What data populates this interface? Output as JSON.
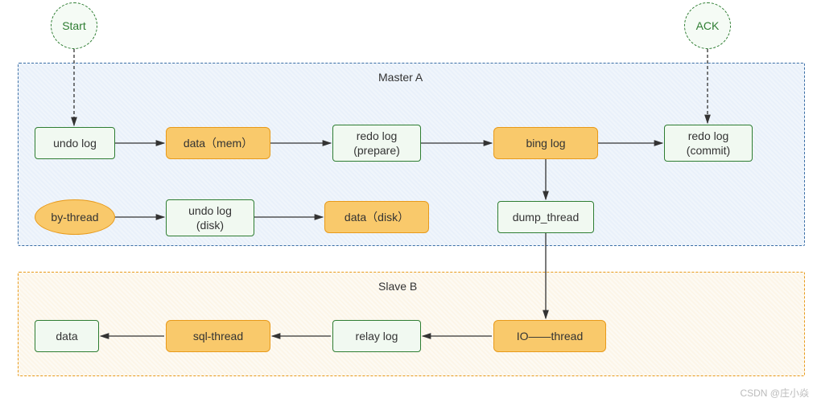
{
  "circles": {
    "start": "Start",
    "ack": "ACK"
  },
  "master": {
    "label": "Master A",
    "row1": {
      "undo_log": "undo log",
      "data_mem": "data（mem）",
      "redo_prepare": "redo log\n(prepare)",
      "bing_log": "bing log",
      "redo_commit": "redo log\n(commit)"
    },
    "row2": {
      "by_thread": "by-thread",
      "undo_disk": "undo log\n(disk)",
      "data_disk": "data（disk）",
      "dump_thread": "dump_thread"
    }
  },
  "slave": {
    "label": "Slave B",
    "data": "data",
    "sql_thread": "sql-thread",
    "relay_log": "relay log",
    "io_thread": "IO——thread"
  },
  "watermark": "CSDN @庄小焱"
}
